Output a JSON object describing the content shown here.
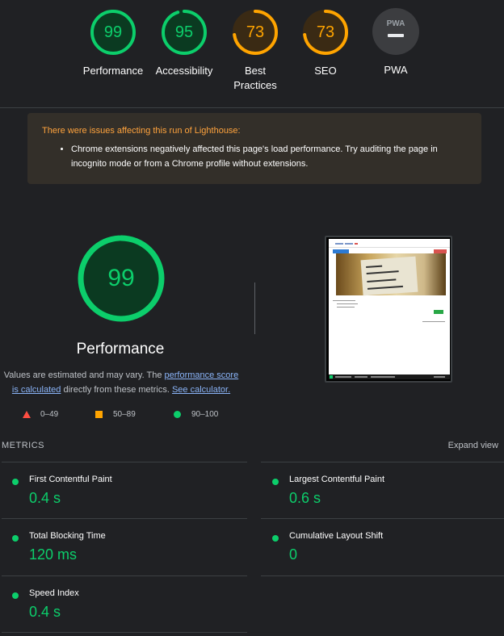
{
  "categories": [
    {
      "label": "Performance",
      "score": "99",
      "value": 99,
      "color": "#0cce6b"
    },
    {
      "label": "Accessibility",
      "score": "95",
      "value": 95,
      "color": "#0cce6b"
    },
    {
      "label": "Best Practices",
      "score": "73",
      "value": 73,
      "color": "#ffa400"
    },
    {
      "label": "SEO",
      "score": "73",
      "value": 73,
      "color": "#ffa400"
    },
    {
      "label": "PWA",
      "badge_text": "PWA"
    }
  ],
  "warning": {
    "title": "There were issues affecting this run of Lighthouse:",
    "item": "Chrome extensions negatively affected this page's load performance. Try auditing the page in incognito mode or from a Chrome profile without extensions."
  },
  "performance": {
    "score": "99",
    "value": 99,
    "title": "Performance",
    "desc_prefix": "Values are estimated and may vary. The ",
    "desc_link1": "performance score is calculated",
    "desc_middle": " directly from these metrics. ",
    "desc_link2": "See calculator."
  },
  "legend": [
    {
      "label": "0–49",
      "color": "#ff4e42"
    },
    {
      "label": "50–89",
      "color": "#ffa400"
    },
    {
      "label": "90–100",
      "color": "#0cce6b"
    }
  ],
  "metrics": {
    "header": "METRICS",
    "expand_label": "Expand view",
    "items": [
      {
        "name": "First Contentful Paint",
        "value": "0.4 s"
      },
      {
        "name": "Largest Contentful Paint",
        "value": "0.6 s"
      },
      {
        "name": "Total Blocking Time",
        "value": "120 ms"
      },
      {
        "name": "Cumulative Layout Shift",
        "value": "0"
      },
      {
        "name": "Speed Index",
        "value": "0.4 s"
      }
    ]
  },
  "colors": {
    "pass": "#0cce6b",
    "average": "#ffa400",
    "fail": "#ff4e42",
    "background": "#202124",
    "warning_title": "#ffa33d"
  }
}
